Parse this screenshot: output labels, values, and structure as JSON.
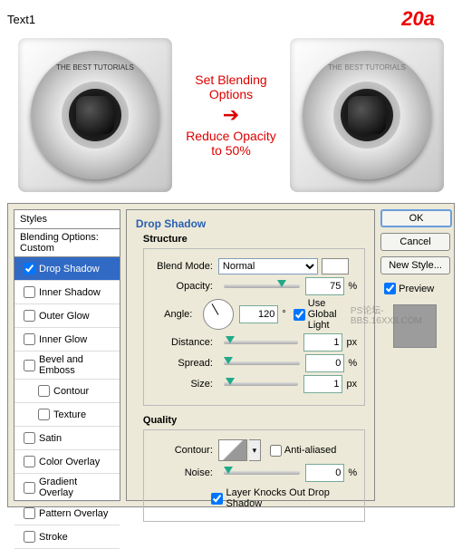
{
  "header": {
    "label": "Text1",
    "step": "20a"
  },
  "instruction": {
    "line1": "Set Blending Options",
    "line2": "Reduce Opacity",
    "line3": "to 50%",
    "arrow": "➔"
  },
  "lens_text": "THE BEST TUTORIALS",
  "watermark": "PS论坛-BBS.16XX8.COM",
  "styles": {
    "heading": "Styles",
    "blending": "Blending Options: Custom",
    "items": [
      {
        "label": "Drop Shadow",
        "checked": true,
        "selected": true
      },
      {
        "label": "Inner Shadow",
        "checked": false
      },
      {
        "label": "Outer Glow",
        "checked": false
      },
      {
        "label": "Inner Glow",
        "checked": false
      },
      {
        "label": "Bevel and Emboss",
        "checked": false
      },
      {
        "label": "Contour",
        "checked": false,
        "indent": true
      },
      {
        "label": "Texture",
        "checked": false,
        "indent": true
      },
      {
        "label": "Satin",
        "checked": false
      },
      {
        "label": "Color Overlay",
        "checked": false
      },
      {
        "label": "Gradient Overlay",
        "checked": false
      },
      {
        "label": "Pattern Overlay",
        "checked": false
      },
      {
        "label": "Stroke",
        "checked": false
      }
    ]
  },
  "main": {
    "title": "Drop Shadow",
    "structure": {
      "heading": "Structure",
      "blend_mode_label": "Blend Mode:",
      "blend_mode_value": "Normal",
      "opacity_label": "Opacity:",
      "opacity_value": "75",
      "angle_label": "Angle:",
      "angle_value": "120",
      "angle_unit": "°",
      "global_light": "Use Global Light",
      "distance_label": "Distance:",
      "distance_value": "1",
      "spread_label": "Spread:",
      "spread_value": "0",
      "size_label": "Size:",
      "size_value": "1",
      "px": "px",
      "pct": "%"
    },
    "quality": {
      "heading": "Quality",
      "contour_label": "Contour:",
      "anti_aliased": "Anti-aliased",
      "noise_label": "Noise:",
      "noise_value": "0",
      "knockout": "Layer Knocks Out Drop Shadow"
    }
  },
  "side": {
    "ok": "OK",
    "cancel": "Cancel",
    "new_style": "New Style...",
    "preview": "Preview"
  }
}
